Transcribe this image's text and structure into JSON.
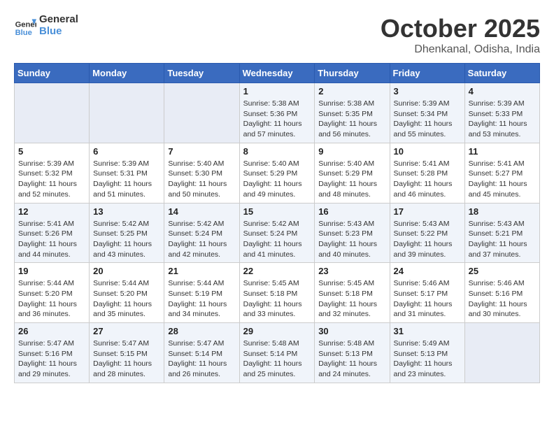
{
  "header": {
    "logo_line1": "General",
    "logo_line2": "Blue",
    "month": "October 2025",
    "location": "Dhenkanal, Odisha, India"
  },
  "weekdays": [
    "Sunday",
    "Monday",
    "Tuesday",
    "Wednesday",
    "Thursday",
    "Friday",
    "Saturday"
  ],
  "weeks": [
    [
      {
        "day": "",
        "info": ""
      },
      {
        "day": "",
        "info": ""
      },
      {
        "day": "",
        "info": ""
      },
      {
        "day": "1",
        "info": "Sunrise: 5:38 AM\nSunset: 5:36 PM\nDaylight: 11 hours\nand 57 minutes."
      },
      {
        "day": "2",
        "info": "Sunrise: 5:38 AM\nSunset: 5:35 PM\nDaylight: 11 hours\nand 56 minutes."
      },
      {
        "day": "3",
        "info": "Sunrise: 5:39 AM\nSunset: 5:34 PM\nDaylight: 11 hours\nand 55 minutes."
      },
      {
        "day": "4",
        "info": "Sunrise: 5:39 AM\nSunset: 5:33 PM\nDaylight: 11 hours\nand 53 minutes."
      }
    ],
    [
      {
        "day": "5",
        "info": "Sunrise: 5:39 AM\nSunset: 5:32 PM\nDaylight: 11 hours\nand 52 minutes."
      },
      {
        "day": "6",
        "info": "Sunrise: 5:39 AM\nSunset: 5:31 PM\nDaylight: 11 hours\nand 51 minutes."
      },
      {
        "day": "7",
        "info": "Sunrise: 5:40 AM\nSunset: 5:30 PM\nDaylight: 11 hours\nand 50 minutes."
      },
      {
        "day": "8",
        "info": "Sunrise: 5:40 AM\nSunset: 5:29 PM\nDaylight: 11 hours\nand 49 minutes."
      },
      {
        "day": "9",
        "info": "Sunrise: 5:40 AM\nSunset: 5:29 PM\nDaylight: 11 hours\nand 48 minutes."
      },
      {
        "day": "10",
        "info": "Sunrise: 5:41 AM\nSunset: 5:28 PM\nDaylight: 11 hours\nand 46 minutes."
      },
      {
        "day": "11",
        "info": "Sunrise: 5:41 AM\nSunset: 5:27 PM\nDaylight: 11 hours\nand 45 minutes."
      }
    ],
    [
      {
        "day": "12",
        "info": "Sunrise: 5:41 AM\nSunset: 5:26 PM\nDaylight: 11 hours\nand 44 minutes."
      },
      {
        "day": "13",
        "info": "Sunrise: 5:42 AM\nSunset: 5:25 PM\nDaylight: 11 hours\nand 43 minutes."
      },
      {
        "day": "14",
        "info": "Sunrise: 5:42 AM\nSunset: 5:24 PM\nDaylight: 11 hours\nand 42 minutes."
      },
      {
        "day": "15",
        "info": "Sunrise: 5:42 AM\nSunset: 5:24 PM\nDaylight: 11 hours\nand 41 minutes."
      },
      {
        "day": "16",
        "info": "Sunrise: 5:43 AM\nSunset: 5:23 PM\nDaylight: 11 hours\nand 40 minutes."
      },
      {
        "day": "17",
        "info": "Sunrise: 5:43 AM\nSunset: 5:22 PM\nDaylight: 11 hours\nand 39 minutes."
      },
      {
        "day": "18",
        "info": "Sunrise: 5:43 AM\nSunset: 5:21 PM\nDaylight: 11 hours\nand 37 minutes."
      }
    ],
    [
      {
        "day": "19",
        "info": "Sunrise: 5:44 AM\nSunset: 5:20 PM\nDaylight: 11 hours\nand 36 minutes."
      },
      {
        "day": "20",
        "info": "Sunrise: 5:44 AM\nSunset: 5:20 PM\nDaylight: 11 hours\nand 35 minutes."
      },
      {
        "day": "21",
        "info": "Sunrise: 5:44 AM\nSunset: 5:19 PM\nDaylight: 11 hours\nand 34 minutes."
      },
      {
        "day": "22",
        "info": "Sunrise: 5:45 AM\nSunset: 5:18 PM\nDaylight: 11 hours\nand 33 minutes."
      },
      {
        "day": "23",
        "info": "Sunrise: 5:45 AM\nSunset: 5:18 PM\nDaylight: 11 hours\nand 32 minutes."
      },
      {
        "day": "24",
        "info": "Sunrise: 5:46 AM\nSunset: 5:17 PM\nDaylight: 11 hours\nand 31 minutes."
      },
      {
        "day": "25",
        "info": "Sunrise: 5:46 AM\nSunset: 5:16 PM\nDaylight: 11 hours\nand 30 minutes."
      }
    ],
    [
      {
        "day": "26",
        "info": "Sunrise: 5:47 AM\nSunset: 5:16 PM\nDaylight: 11 hours\nand 29 minutes."
      },
      {
        "day": "27",
        "info": "Sunrise: 5:47 AM\nSunset: 5:15 PM\nDaylight: 11 hours\nand 28 minutes."
      },
      {
        "day": "28",
        "info": "Sunrise: 5:47 AM\nSunset: 5:14 PM\nDaylight: 11 hours\nand 26 minutes."
      },
      {
        "day": "29",
        "info": "Sunrise: 5:48 AM\nSunset: 5:14 PM\nDaylight: 11 hours\nand 25 minutes."
      },
      {
        "day": "30",
        "info": "Sunrise: 5:48 AM\nSunset: 5:13 PM\nDaylight: 11 hours\nand 24 minutes."
      },
      {
        "day": "31",
        "info": "Sunrise: 5:49 AM\nSunset: 5:13 PM\nDaylight: 11 hours\nand 23 minutes."
      },
      {
        "day": "",
        "info": ""
      }
    ]
  ]
}
